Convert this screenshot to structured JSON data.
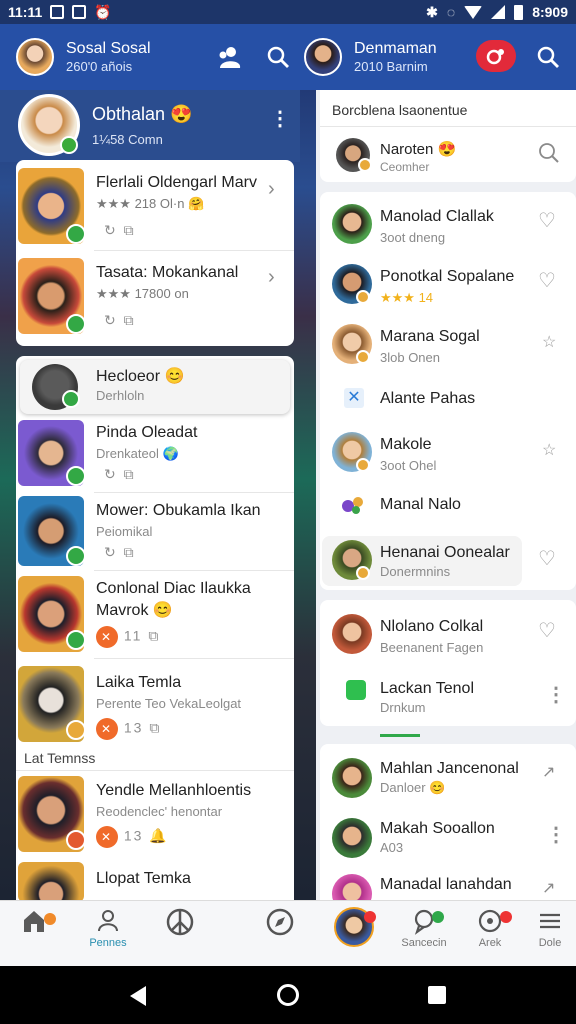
{
  "status": {
    "time_left": "11:11",
    "time_right": "8:909"
  },
  "header": {
    "left": {
      "title": "Sosal Sosal",
      "subtitle": "260'0 añois"
    },
    "right": {
      "title": "Denmaman",
      "subtitle": "2010 Barnim"
    }
  },
  "left": {
    "profile": {
      "name": "Obthalan 😍",
      "sub": "1¼58 Comn"
    },
    "featured": [
      {
        "name": "Flerlali Oldengarl Marv",
        "sub": "★★★ 218 Ol·n 🤗",
        "icons": "↻ ⧉"
      },
      {
        "name": "Tasata: Mokankanal",
        "sub": "★★★ 17800 on",
        "icons": "↻ ⧉"
      }
    ],
    "chats": [
      {
        "name": "Hecloeor 😊",
        "sub": "Derhloln",
        "icons": ""
      },
      {
        "name": "Pinda Oleadat",
        "sub": "Drenkateol 🌍",
        "icons": "↻ ⧉"
      },
      {
        "name": "Mower: Obukamla Ikan",
        "sub": "Peiomikal",
        "icons": "↻ ⧉"
      },
      {
        "name": "Conlonal Diac Ilaukka",
        "name2": "Mavrok 😊",
        "sub": "",
        "icons": "11 ⧉"
      },
      {
        "name": "Laika Temla",
        "sub": "Perente Teo VekaLeolgat",
        "icons": "13 ⧉"
      }
    ],
    "section_label": "Lat Temnss",
    "more": [
      {
        "name": "Yendle Mellanhloentis",
        "sub": "Reodenclec' henontar",
        "icons": "13 🔔"
      },
      {
        "name": "Llopat Temka",
        "sub": "",
        "icons": ""
      }
    ]
  },
  "right": {
    "section_title": "Borcblena lsaonentue",
    "search": {
      "name": "Naroten 😍",
      "sub": "Ceomher"
    },
    "contacts": [
      {
        "name": "Manolad Clallak",
        "sub": "3oot dneng"
      },
      {
        "name": "Ponotkal Sopalane",
        "sub": "★★★ 14"
      },
      {
        "name": "Marana Sogal",
        "sub": "3lob Onen"
      },
      {
        "name": "Alante Pahas",
        "sub": ""
      },
      {
        "name": "Makole",
        "sub": "3oot Ohel"
      },
      {
        "name": "Manal Nalo",
        "sub": ""
      },
      {
        "name": "Henanai Oonealar",
        "sub": "Donermnins"
      }
    ],
    "contacts2": [
      {
        "name": "Nlolano Colkal",
        "sub": "Beenanent Fagen"
      },
      {
        "name": "Lackan Tenol",
        "sub": "Drnkum"
      },
      {
        "name": "Mahlan Jancenonal",
        "sub": "Danloer 😊"
      },
      {
        "name": "Makah Sooallon",
        "sub": "A03"
      },
      {
        "name": "Manadal lanahdan",
        "sub": ""
      }
    ]
  },
  "nav": {
    "items": [
      {
        "label": "",
        "icon": "home-icon"
      },
      {
        "label": "Pennes",
        "icon": "people-icon"
      },
      {
        "label": "",
        "icon": "peace-icon"
      },
      {
        "label": "",
        "icon": "compass-icon"
      },
      {
        "label": "",
        "icon": "avatar"
      },
      {
        "label": "Sancecin",
        "icon": "chat-icon"
      },
      {
        "label": "Arek",
        "icon": "target-icon"
      },
      {
        "label": "Dole",
        "icon": "menu-icon"
      }
    ]
  }
}
